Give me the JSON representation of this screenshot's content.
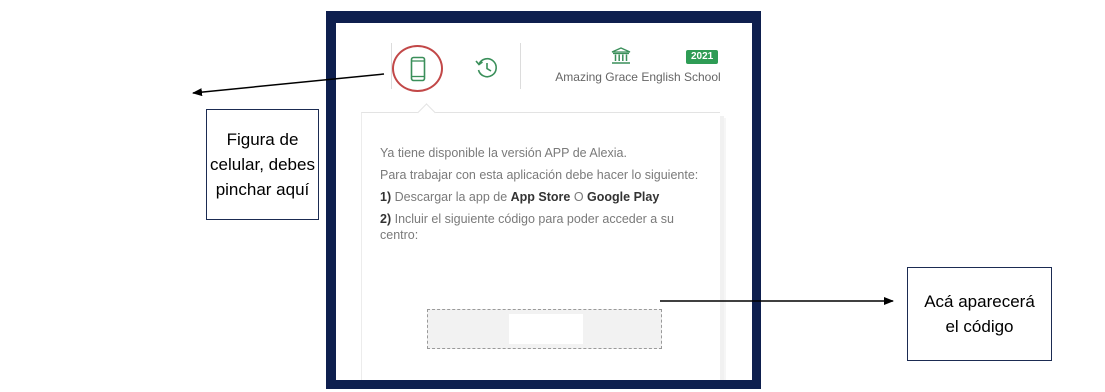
{
  "toolbar": {
    "phone_icon": "smartphone-icon",
    "history_icon": "history-icon",
    "school_icon": "bank-icon",
    "year": "2021",
    "school_name": "Amazing Grace English School"
  },
  "popup": {
    "line1": "Ya tiene disponible la versión APP de Alexia.",
    "line2": "Para trabajar con esta aplicación debe hacer lo siguiente:",
    "step1_num": "1)",
    "step1_text_a": " Descargar la app de ",
    "step1_app_store": "App Store",
    "step1_or": " O ",
    "step1_google_play": "Google Play",
    "step2_num": "2)",
    "step2_text": " Incluir el siguiente código para poder acceder a su centro:",
    "code": ""
  },
  "callouts": {
    "left": "Figura de\ncelular, debes\npinchar aquí",
    "right": "Acá aparecerá\nel código"
  },
  "colors": {
    "frame": "#0e1f4e",
    "badge": "#2e9c55",
    "highlight_circle": "#c24848",
    "icon_green": "#3a8f5a"
  }
}
